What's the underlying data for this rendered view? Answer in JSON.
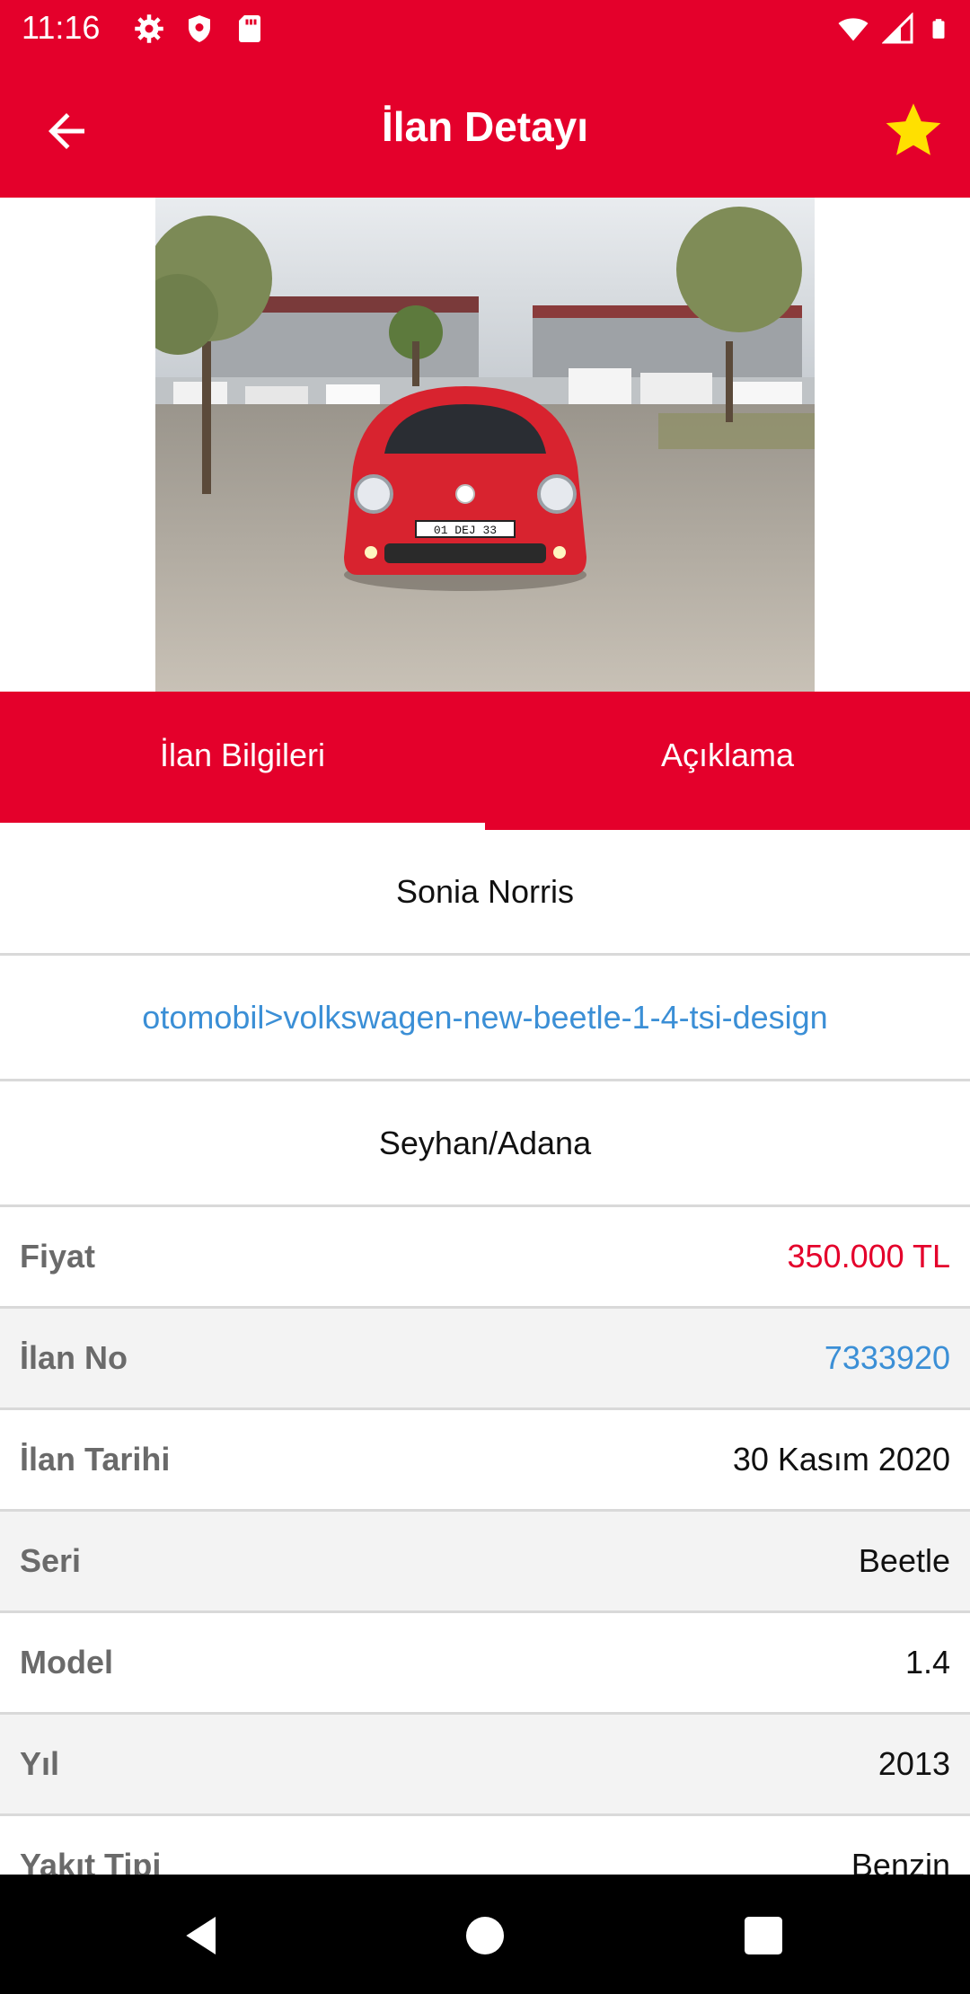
{
  "status_bar": {
    "time": "11:16",
    "left_icons": [
      "gear-icon",
      "shield-icon",
      "sd-card-icon"
    ],
    "right_icons": [
      "wifi-icon",
      "signal-icon",
      "battery-icon"
    ]
  },
  "app_bar": {
    "title": "İlan Detayı",
    "back_icon": "arrow-left-icon",
    "favorite_icon": "star-icon",
    "accent_color": "#e4002b",
    "star_color": "#ffe000"
  },
  "tabs": [
    {
      "label": "İlan Bilgileri",
      "selected": true
    },
    {
      "label": "Açıklama",
      "selected": false
    }
  ],
  "info": {
    "seller_name": "Sonia Norris",
    "category_link": "otomobil>volkswagen-new-beetle-1-4-tsi-design",
    "location": "Seyhan/Adana"
  },
  "details": [
    {
      "label": "Fiyat",
      "value": "350.000 TL"
    },
    {
      "label": "İlan No",
      "value": "7333920"
    },
    {
      "label": "İlan Tarihi",
      "value": "30 Kasım 2020"
    },
    {
      "label": "Seri",
      "value": "Beetle"
    },
    {
      "label": "Model",
      "value": "1.4"
    },
    {
      "label": "Yıl",
      "value": "2013"
    },
    {
      "label": "Yakıt Tipi",
      "value": "Benzin"
    }
  ],
  "photo": {
    "plate": "01 DEJ 33"
  }
}
